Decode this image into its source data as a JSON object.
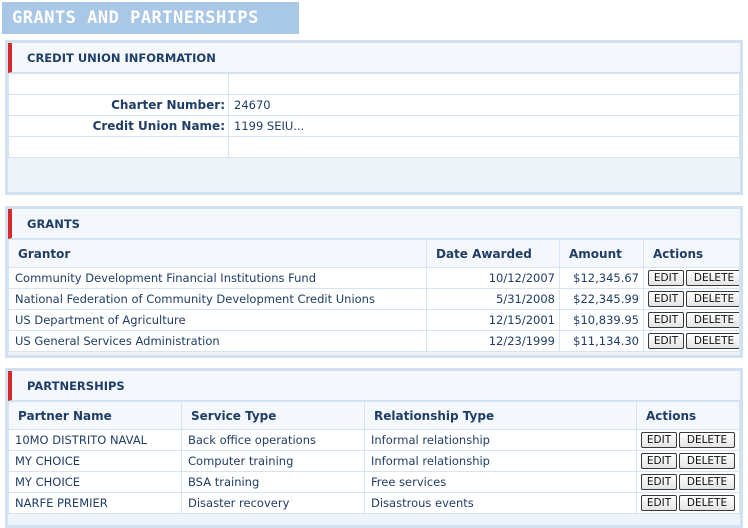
{
  "page": {
    "title": "GRANTS AND PARTNERSHIPS"
  },
  "credit_union": {
    "header": "CREDIT UNION INFORMATION",
    "charter_label": "Charter Number:",
    "charter_value": "24670",
    "name_label": "Credit Union Name:",
    "name_value": "1199 SEIU..."
  },
  "grants": {
    "header": "GRANTS",
    "columns": {
      "grantor": "Grantor",
      "date": "Date Awarded",
      "amount": "Amount",
      "actions": "Actions"
    },
    "rows": [
      {
        "grantor": "Community Development Financial Institutions Fund",
        "date": "10/12/2007",
        "amount": "$12,345.67"
      },
      {
        "grantor": "National Federation of Community Development Credit Unions",
        "date": "5/31/2008",
        "amount": "$22,345.99"
      },
      {
        "grantor": "US Department of Agriculture",
        "date": "12/15/2001",
        "amount": "$10,839.95"
      },
      {
        "grantor": "US General Services Administration",
        "date": "12/23/1999",
        "amount": "$11,134.30"
      }
    ]
  },
  "partnerships": {
    "header": "PARTNERSHIPS",
    "columns": {
      "partner": "Partner Name",
      "service": "Service Type",
      "relationship": "Relationship Type",
      "actions": "Actions"
    },
    "rows": [
      {
        "partner": "10MO DISTRITO NAVAL",
        "service": "Back office operations",
        "relationship": "Informal relationship"
      },
      {
        "partner": "MY CHOICE",
        "service": "Computer training",
        "relationship": "Informal relationship"
      },
      {
        "partner": "MY CHOICE",
        "service": "BSA training",
        "relationship": "Free services"
      },
      {
        "partner": "NARFE PREMIER",
        "service": "Disaster recovery",
        "relationship": "Disastrous events"
      }
    ]
  },
  "buttons": {
    "edit": "EDIT",
    "delete": "DELETE"
  }
}
